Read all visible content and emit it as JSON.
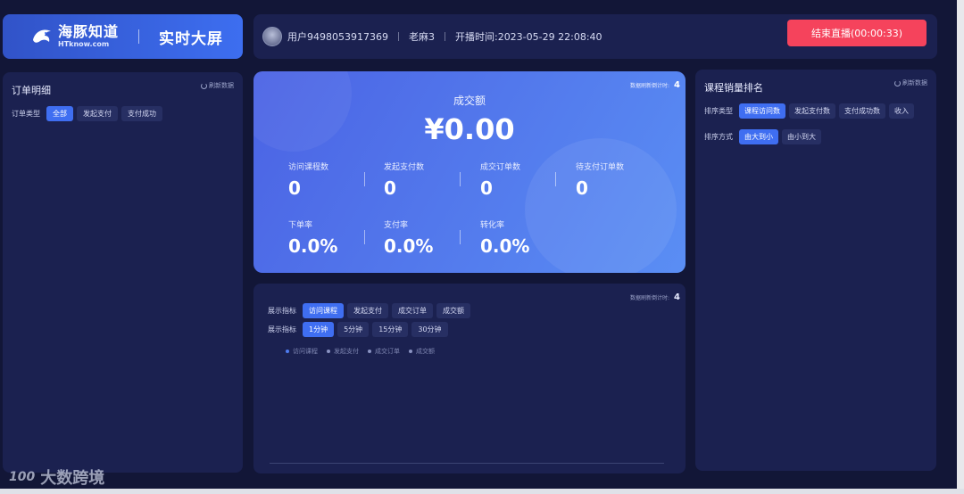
{
  "header": {
    "brand_cn": "海豚知道",
    "brand_en": "HTknow.com",
    "screen_title": "实时大屏"
  },
  "info": {
    "user": "用户9498053917369",
    "teacher": "老麻3",
    "start_time": "开播时间:2023-05-29 22:08:40",
    "end_button": "结束直播(00:00:33)"
  },
  "order_panel": {
    "title": "订单明细",
    "refresh": "刷新数据",
    "filter_label": "订单类型",
    "filters": [
      "全部",
      "发起支付",
      "支付成功"
    ]
  },
  "stats": {
    "countdown_label": "数据刷新倒计时:",
    "countdown_value": "4",
    "gmv_label": "成交额",
    "gmv_value": "¥0.00",
    "items": [
      {
        "label": "访问课程数",
        "value": "0"
      },
      {
        "label": "发起支付数",
        "value": "0"
      },
      {
        "label": "成交订单数",
        "value": "0"
      },
      {
        "label": "待支付订单数",
        "value": "0"
      },
      {
        "label": "下单率",
        "value": "0.0%"
      },
      {
        "label": "支付率",
        "value": "0.0%"
      },
      {
        "label": "转化率",
        "value": "0.0%"
      }
    ]
  },
  "chart_panel": {
    "countdown_label": "数据刷新倒计时:",
    "countdown_value": "4",
    "metric_label": "展示指标",
    "metrics": [
      "访问课程",
      "发起支付",
      "成交订单",
      "成交额"
    ],
    "interval_label": "展示指标",
    "intervals": [
      "1分钟",
      "5分钟",
      "15分钟",
      "30分钟"
    ],
    "legend": [
      "访问课程",
      "发起支付",
      "成交订单",
      "成交额"
    ],
    "legend_colors": [
      "#4f7cf0",
      "#8a93c2",
      "#8a93c2",
      "#8a93c2"
    ]
  },
  "rank_panel": {
    "title": "课程销量排名",
    "refresh": "刷新数据",
    "sort_type_label": "排序类型",
    "sort_types": [
      "课程访问数",
      "发起支付数",
      "支付成功数",
      "收入"
    ],
    "sort_order_label": "排序方式",
    "sort_orders": [
      "由大到小",
      "由小到大"
    ]
  },
  "watermark": {
    "logo": "100",
    "text": "大数跨境"
  }
}
